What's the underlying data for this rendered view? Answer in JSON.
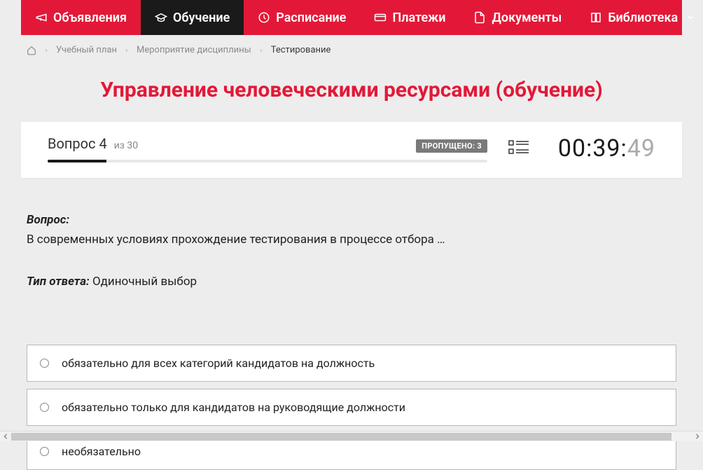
{
  "nav": {
    "items": [
      {
        "label": "Объявления",
        "icon": "megaphone"
      },
      {
        "label": "Обучение",
        "icon": "grad-cap",
        "active": true
      },
      {
        "label": "Расписание",
        "icon": "clock"
      },
      {
        "label": "Платежи",
        "icon": "card"
      },
      {
        "label": "Документы",
        "icon": "doc"
      },
      {
        "label": "Библиотека",
        "icon": "book",
        "dropdown": true
      }
    ]
  },
  "breadcrumb": {
    "items": [
      {
        "label": "Учебный план"
      },
      {
        "label": "Мероприятие дисциплины"
      },
      {
        "label": "Тестирование",
        "current": true
      }
    ]
  },
  "page_title": "Управление человеческими ресурсами (обучение)",
  "status": {
    "question_label": "Вопрос 4",
    "of_text": "из 30",
    "skipped_label": "ПРОПУЩЕНО: 3",
    "progress_percent": 13.3,
    "timer_main": "00:39:",
    "timer_secs": "49"
  },
  "question": {
    "head_label": "Вопрос:",
    "text": "В современных условиях прохождение тестирования в процессе отбора …",
    "type_label": "Тип ответа:",
    "type_value": "Одиночный выбор"
  },
  "options": [
    {
      "text": "обязательно для всех категорий кандидатов на должность"
    },
    {
      "text": "обязательно только для кандидатов на руководящие должности"
    },
    {
      "text": "необязательно"
    }
  ]
}
